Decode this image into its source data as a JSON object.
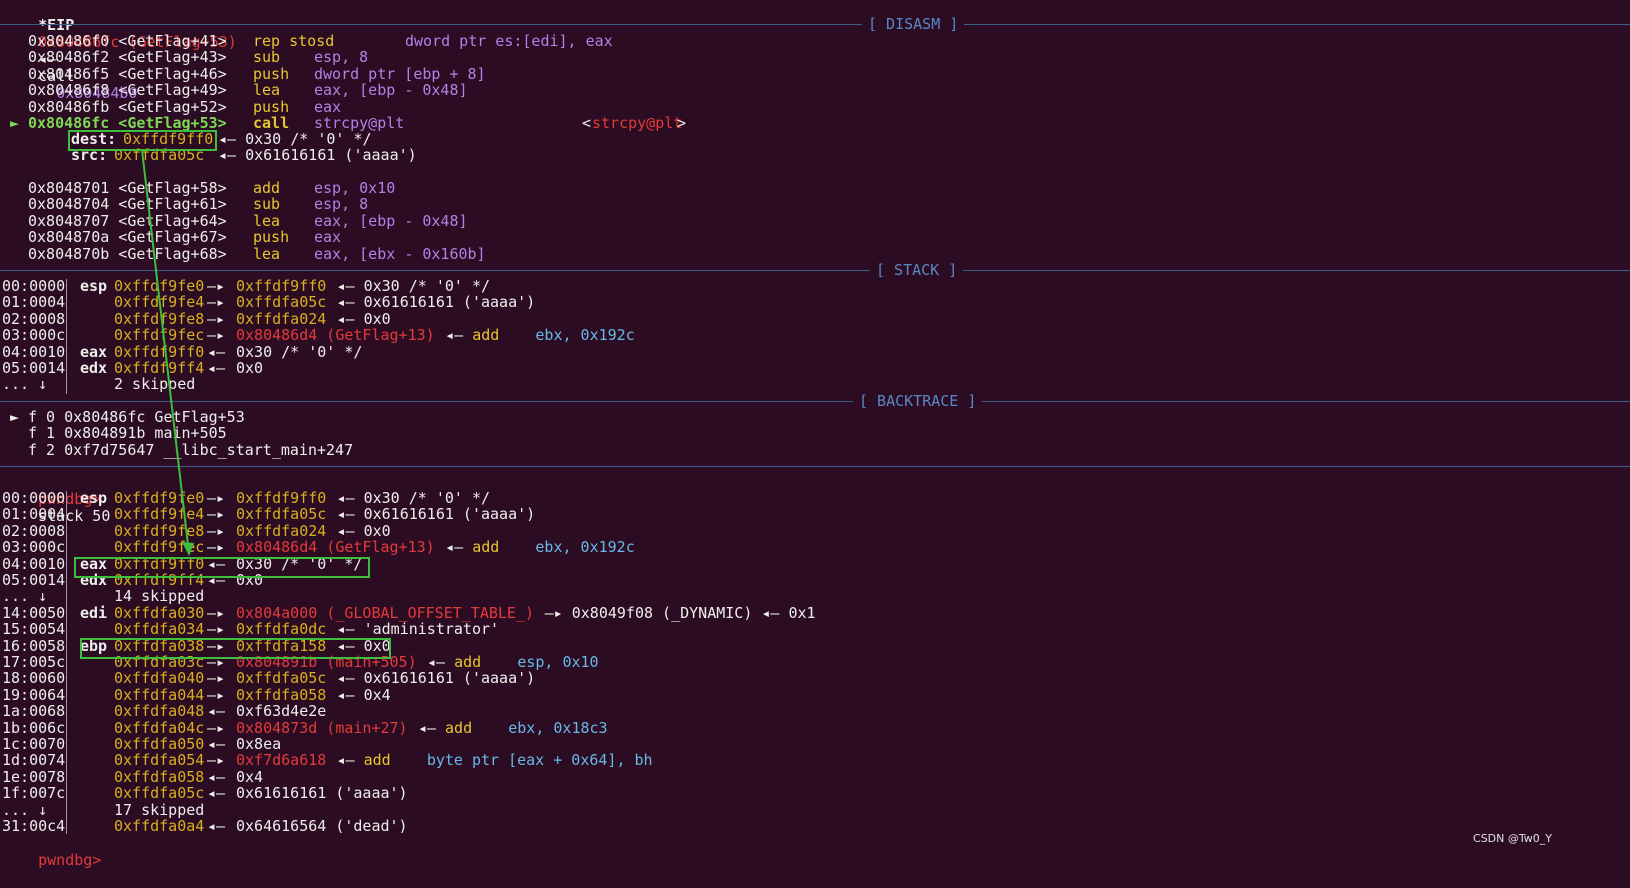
{
  "eip_line": {
    "label": "*EIP",
    "addr": "0x80486fc (GetFlag+53)",
    "arrow": "◂—",
    "op": "call",
    "target": "0x80484b0"
  },
  "sections": {
    "disasm": "[ DISASM ]",
    "stack": "[ STACK ]",
    "backtrace": "[ BACKTRACE ]"
  },
  "disasm": [
    {
      "addr": "0x80486f0 <GetFlag+41>",
      "mn": "rep stosd",
      "ops": "dword ptr es:[edi], eax"
    },
    {
      "addr": "0x80486f2 <GetFlag+43>",
      "mn": "sub",
      "ops": "esp, 8"
    },
    {
      "addr": "0x80486f5 <GetFlag+46>",
      "mn": "push",
      "ops": "dword ptr [ebp + 8]"
    },
    {
      "addr": "0x80486f8 <GetFlag+49>",
      "mn": "lea",
      "ops": "eax, [ebp - 0x48]"
    },
    {
      "addr": "0x80486fb <GetFlag+52>",
      "mn": "push",
      "ops": "eax"
    }
  ],
  "current": {
    "marker": "►",
    "addr": "0x80486fc <GetFlag+53>",
    "mn": "call",
    "ops": "strcpy@plt",
    "sym_open": "<",
    "sym": "strcpy@plt",
    "sym_close": ">"
  },
  "args": [
    {
      "name": "dest:",
      "addr": "0xffdf9ff0",
      "rest": "◂— 0x30 /* '0' */"
    },
    {
      "name": "src:",
      "addr": "0xffdfa05c",
      "rest": "◂— 0x61616161 ('aaaa')"
    }
  ],
  "disasm2": [
    {
      "addr": "0x8048701 <GetFlag+58>",
      "mn": "add",
      "ops": "esp, 0x10"
    },
    {
      "addr": "0x8048704 <GetFlag+61>",
      "mn": "sub",
      "ops": "esp, 8"
    },
    {
      "addr": "0x8048707 <GetFlag+64>",
      "mn": "lea",
      "ops": "eax, [ebp - 0x48]"
    },
    {
      "addr": "0x804870a <GetFlag+67>",
      "mn": "push",
      "ops": "eax"
    },
    {
      "addr": "0x804870b <GetFlag+68>",
      "mn": "lea",
      "ops": "eax, [ebx - 0x160b]"
    }
  ],
  "stack": [
    {
      "off": "00:0000",
      "reg": "esp",
      "addr": "0xffdf9fe0",
      "arrow": "—▸",
      "val": "0xffdf9ff0",
      "rest": "◂— 0x30 /* '0' */"
    },
    {
      "off": "01:0004",
      "reg": "",
      "addr": "0xffdf9fe4",
      "arrow": "—▸",
      "val": "0xffdfa05c",
      "rest": "◂— 0x61616161 ('aaaa')"
    },
    {
      "off": "02:0008",
      "reg": "",
      "addr": "0xffdf9fe8",
      "arrow": "—▸",
      "val": "0xffdfa024",
      "rest": "◂— 0x0"
    },
    {
      "off": "03:000c",
      "reg": "",
      "addr": "0xffdf9fec",
      "arrow": "—▸",
      "val": "0x80486d4 (GetFlag+13)",
      "rest": "◂— add    ebx, 0x192c"
    },
    {
      "off": "04:0010",
      "reg": "eax",
      "addr": "0xffdf9ff0",
      "arrow": "◂—",
      "val": "",
      "rest": "0x30 /* '0' */"
    },
    {
      "off": "05:0014",
      "reg": "edx",
      "addr": "0xffdf9ff4",
      "arrow": "◂—",
      "val": "",
      "rest": "0x0"
    },
    {
      "off": "... ↓",
      "reg": "",
      "addr": "",
      "arrow": "",
      "val": "",
      "rest": "2 skipped"
    }
  ],
  "backtrace": [
    {
      "marker": "►",
      "text": "f 0 0x80486fc GetFlag+53"
    },
    {
      "marker": "",
      "text": "f 1 0x804891b main+505"
    },
    {
      "marker": "",
      "text": "f 2 0xf7d75647 __libc_start_main+247"
    }
  ],
  "prompt": {
    "label": "pwndbg>",
    "cmd": "stack 50"
  },
  "stack50": [
    {
      "off": "00:0000",
      "reg": "esp",
      "addr": "0xffdf9fe0",
      "arrow": "—▸",
      "val": "0xffdf9ff0",
      "rest": "◂— 0x30 /* '0' */"
    },
    {
      "off": "01:0004",
      "reg": "",
      "addr": "0xffdf9fe4",
      "arrow": "—▸",
      "val": "0xffdfa05c",
      "rest": "◂— 0x61616161 ('aaaa')"
    },
    {
      "off": "02:0008",
      "reg": "",
      "addr": "0xffdf9fe8",
      "arrow": "—▸",
      "val": "0xffdfa024",
      "rest": "◂— 0x0"
    },
    {
      "off": "03:000c",
      "reg": "",
      "addr": "0xffdf9fec",
      "arrow": "—▸",
      "val": "0x80486d4 (GetFlag+13)",
      "rest": "◂— add    ebx, 0x192c"
    },
    {
      "off": "04:0010",
      "reg": "eax",
      "addr": "0xffdf9ff0",
      "arrow": "◂—",
      "val": "",
      "rest": "0x30 /* '0' */"
    },
    {
      "off": "05:0014",
      "reg": "edx",
      "addr": "0xffdf9ff4",
      "arrow": "◂—",
      "val": "",
      "rest": "0x0"
    },
    {
      "off": "... ↓",
      "reg": "",
      "addr": "",
      "arrow": "",
      "val": "",
      "rest": "14 skipped"
    },
    {
      "off": "14:0050",
      "reg": "edi",
      "addr": "0xffdfa030",
      "arrow": "—▸",
      "val": "0x804a000 (_GLOBAL_OFFSET_TABLE_)",
      "rest": "—▸ 0x8049f08 (_DYNAMIC) ◂— 0x1"
    },
    {
      "off": "15:0054",
      "reg": "",
      "addr": "0xffdfa034",
      "arrow": "—▸",
      "val": "0xffdfa0dc",
      "rest": "◂— 'administrator'"
    },
    {
      "off": "16:0058",
      "reg": "ebp",
      "addr": "0xffdfa038",
      "arrow": "—▸",
      "val": "0xffdfa158",
      "rest": "◂— 0x0"
    },
    {
      "off": "17:005c",
      "reg": "",
      "addr": "0xffdfa03c",
      "arrow": "—▸",
      "val": "0x804891b (main+505)",
      "rest": "◂— add    esp, 0x10"
    },
    {
      "off": "18:0060",
      "reg": "",
      "addr": "0xffdfa040",
      "arrow": "—▸",
      "val": "0xffdfa05c",
      "rest": "◂— 0x61616161 ('aaaa')"
    },
    {
      "off": "19:0064",
      "reg": "",
      "addr": "0xffdfa044",
      "arrow": "—▸",
      "val": "0xffdfa058",
      "rest": "◂— 0x4"
    },
    {
      "off": "1a:0068",
      "reg": "",
      "addr": "0xffdfa048",
      "arrow": "◂—",
      "val": "",
      "rest": "0xf63d4e2e"
    },
    {
      "off": "1b:006c",
      "reg": "",
      "addr": "0xffdfa04c",
      "arrow": "—▸",
      "val": "0x804873d (main+27)",
      "rest": "◂— add    ebx, 0x18c3"
    },
    {
      "off": "1c:0070",
      "reg": "",
      "addr": "0xffdfa050",
      "arrow": "◂—",
      "val": "",
      "rest": "0x8ea"
    },
    {
      "off": "1d:0074",
      "reg": "",
      "addr": "0xffdfa054",
      "arrow": "—▸",
      "val": "0xf7d6a618",
      "rest": "◂— add    byte ptr [eax + 0x64], bh"
    },
    {
      "off": "1e:0078",
      "reg": "",
      "addr": "0xffdfa058",
      "arrow": "◂—",
      "val": "",
      "rest": "0x4"
    },
    {
      "off": "1f:007c",
      "reg": "",
      "addr": "0xffdfa05c",
      "arrow": "◂—",
      "val": "",
      "rest": "0x61616161 ('aaaa')"
    },
    {
      "off": "... ↓",
      "reg": "",
      "addr": "",
      "arrow": "",
      "val": "",
      "rest": "17 skipped"
    },
    {
      "off": "31:00c4",
      "reg": "",
      "addr": "0xffdfa0a4",
      "arrow": "◂—",
      "val": "",
      "rest": "0x64616564 ('dead')"
    }
  ],
  "prompt_end": "pwndbg>",
  "watermark": "CSDN @Tw0_Y",
  "colors": {
    "background": "#2b0c22",
    "highlight_box": "#3cbf3c",
    "section": "#5a87c4",
    "prompt": "#e23b3b"
  }
}
